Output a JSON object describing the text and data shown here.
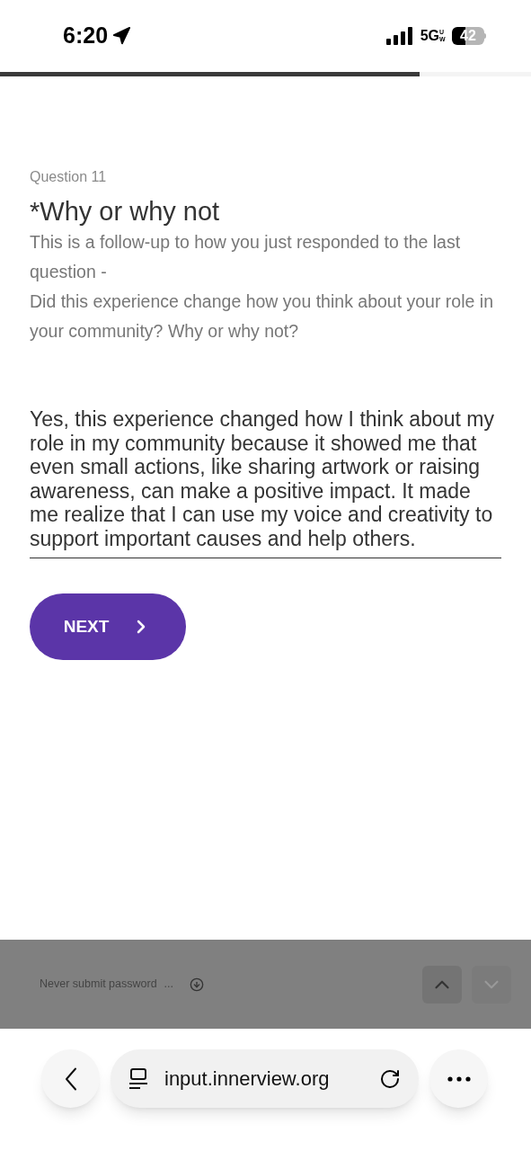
{
  "status_bar": {
    "time": "6:20",
    "network": "5G",
    "network_suffix": "UW",
    "battery": "42"
  },
  "progress": {
    "level": 0.79
  },
  "question": {
    "number": "Question 11",
    "title": "*Why or why not",
    "description": [
      "This is a follow-up to how you just responded to the last question -",
      "Did this experience change how you think about your role in your community? Why or why not?"
    ],
    "answer": "Yes, this experience changed how I think about my role in my community because it showed me that even small actions, like sharing artwork or raising awareness, can make a positive impact. It made me realize that I can use my voice and creativity to support important causes and help others."
  },
  "next_button": {
    "label": "NEXT"
  },
  "form_bar": {
    "notice": "Never submit password",
    "more": "...",
    "up_disabled": false,
    "down_disabled": true
  },
  "browser_bar": {
    "url": "input.innerview.org"
  }
}
